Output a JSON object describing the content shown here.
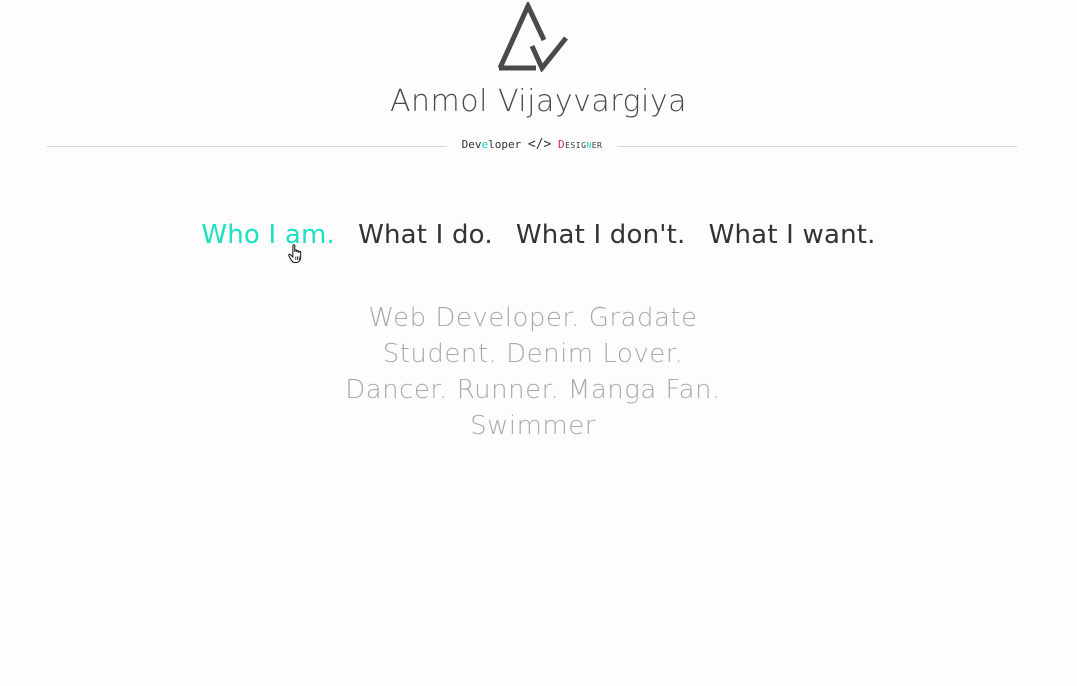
{
  "header": {
    "name": "Anmol Vijayvargiya",
    "tagline": {
      "developer_prefix": "Dev",
      "developer_accent": "e",
      "developer_suffix": "loper",
      "code_symbol": "</>",
      "designer_first": "D",
      "designer_middle": "esig",
      "designer_accent": "n",
      "designer_last": "er"
    },
    "logo_icon": "triangle-logo-icon"
  },
  "nav": {
    "tabs": [
      {
        "label": "Who I am.",
        "active": true
      },
      {
        "label": "What I do.",
        "active": false
      },
      {
        "label": "What I don't.",
        "active": false
      },
      {
        "label": "What I want.",
        "active": false
      }
    ]
  },
  "main": {
    "lines": [
      "Web Developer. Gradate",
      "Student. Denim Lover.",
      "Dancer. Runner. Manga Fan.",
      "Swimmer"
    ]
  },
  "colors": {
    "accent": "#1de0c3",
    "accent_pink": "#d6246e",
    "text_dark": "#333333",
    "text_muted": "#a9a9a9"
  },
  "cursor_icon": "hand-pointer-icon"
}
